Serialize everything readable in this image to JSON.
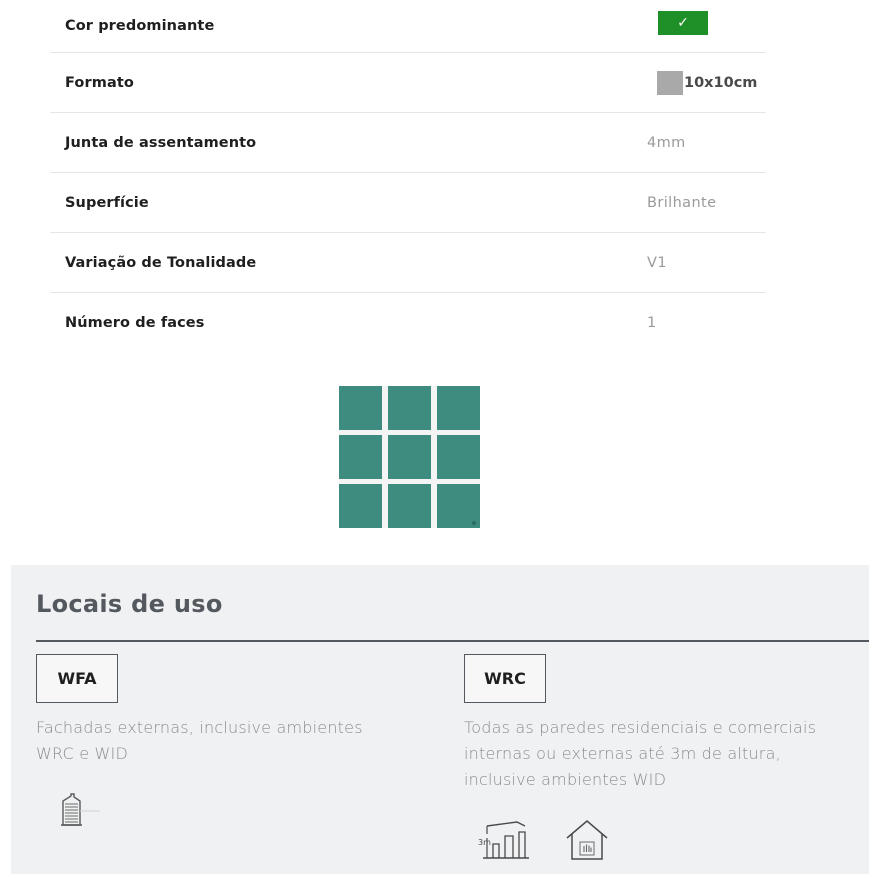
{
  "specs": [
    {
      "label": "Cor predominante",
      "value": "✓",
      "kind": "color",
      "color": "#1f8f27"
    },
    {
      "label": "Formato",
      "value": "10x10cm",
      "kind": "format",
      "color": "#a9a9a9"
    },
    {
      "label": "Junta de assentamento",
      "value": "4mm",
      "kind": "text"
    },
    {
      "label": "Superfície",
      "value": "Brilhante",
      "kind": "text"
    },
    {
      "label": "Variação de Tonalidade",
      "value": "V1",
      "kind": "text"
    },
    {
      "label": "Número de faces",
      "value": "1",
      "kind": "text"
    }
  ],
  "tile": {
    "color": "#3e8b7f",
    "rows": 3,
    "cols": 3
  },
  "uses": {
    "title": "Locais de uso",
    "items": [
      {
        "code": "WFA",
        "description_lines": [
          "Fachadas externas, inclusive ambientes",
          "WRC e WID"
        ],
        "icons": [
          "building-icon"
        ]
      },
      {
        "code": "WRC",
        "description_lines": [
          "Todas as paredes residenciais e comerciais",
          "internas ou externas até 3m de altura,",
          "inclusive ambientes WID"
        ],
        "icon_label": "3m",
        "icons": [
          "wall-height-3m-icon",
          "house-hand-icon"
        ]
      }
    ]
  }
}
